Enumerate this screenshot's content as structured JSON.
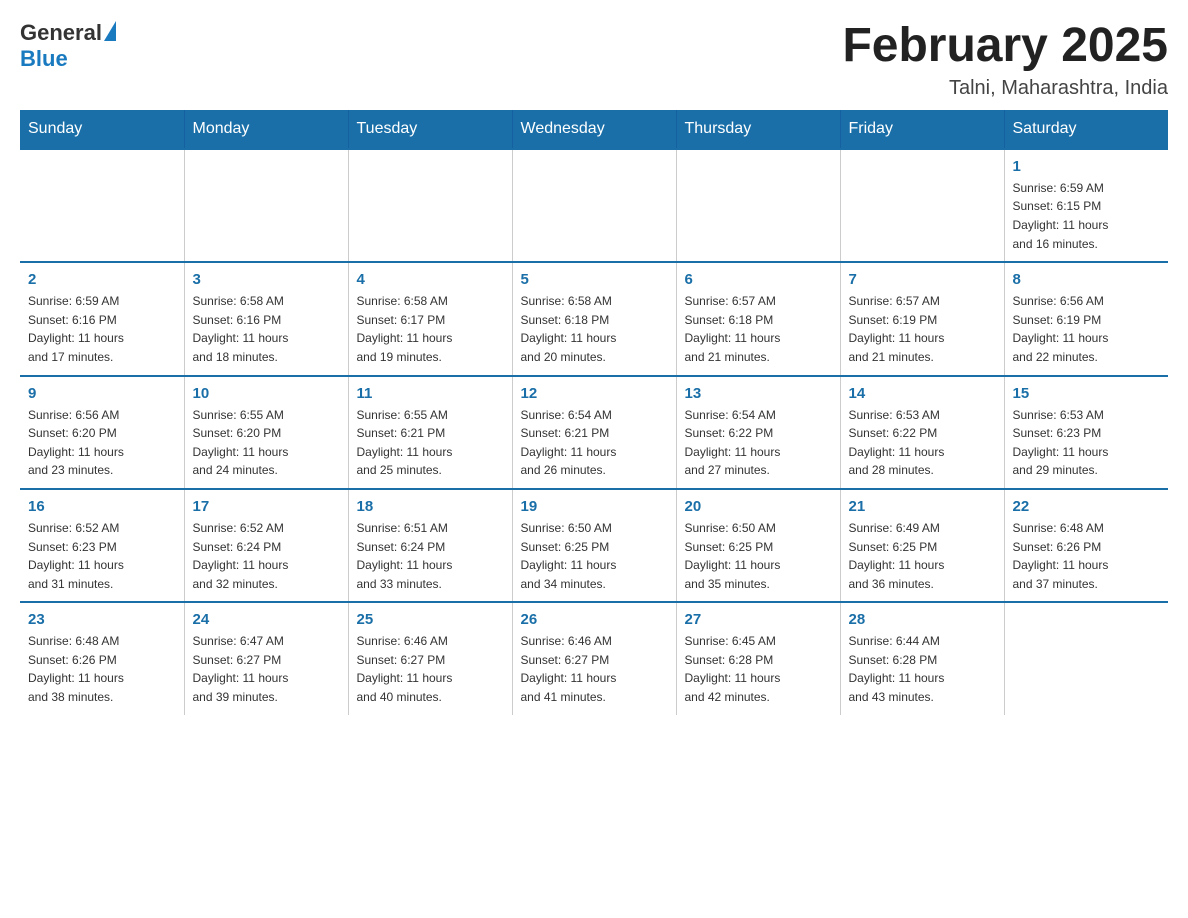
{
  "header": {
    "logo_general": "General",
    "logo_blue": "Blue",
    "month_year": "February 2025",
    "location": "Talni, Maharashtra, India"
  },
  "weekdays": [
    "Sunday",
    "Monday",
    "Tuesday",
    "Wednesday",
    "Thursday",
    "Friday",
    "Saturday"
  ],
  "weeks": [
    [
      {
        "day": "",
        "info": ""
      },
      {
        "day": "",
        "info": ""
      },
      {
        "day": "",
        "info": ""
      },
      {
        "day": "",
        "info": ""
      },
      {
        "day": "",
        "info": ""
      },
      {
        "day": "",
        "info": ""
      },
      {
        "day": "1",
        "info": "Sunrise: 6:59 AM\nSunset: 6:15 PM\nDaylight: 11 hours\nand 16 minutes."
      }
    ],
    [
      {
        "day": "2",
        "info": "Sunrise: 6:59 AM\nSunset: 6:16 PM\nDaylight: 11 hours\nand 17 minutes."
      },
      {
        "day": "3",
        "info": "Sunrise: 6:58 AM\nSunset: 6:16 PM\nDaylight: 11 hours\nand 18 minutes."
      },
      {
        "day": "4",
        "info": "Sunrise: 6:58 AM\nSunset: 6:17 PM\nDaylight: 11 hours\nand 19 minutes."
      },
      {
        "day": "5",
        "info": "Sunrise: 6:58 AM\nSunset: 6:18 PM\nDaylight: 11 hours\nand 20 minutes."
      },
      {
        "day": "6",
        "info": "Sunrise: 6:57 AM\nSunset: 6:18 PM\nDaylight: 11 hours\nand 21 minutes."
      },
      {
        "day": "7",
        "info": "Sunrise: 6:57 AM\nSunset: 6:19 PM\nDaylight: 11 hours\nand 21 minutes."
      },
      {
        "day": "8",
        "info": "Sunrise: 6:56 AM\nSunset: 6:19 PM\nDaylight: 11 hours\nand 22 minutes."
      }
    ],
    [
      {
        "day": "9",
        "info": "Sunrise: 6:56 AM\nSunset: 6:20 PM\nDaylight: 11 hours\nand 23 minutes."
      },
      {
        "day": "10",
        "info": "Sunrise: 6:55 AM\nSunset: 6:20 PM\nDaylight: 11 hours\nand 24 minutes."
      },
      {
        "day": "11",
        "info": "Sunrise: 6:55 AM\nSunset: 6:21 PM\nDaylight: 11 hours\nand 25 minutes."
      },
      {
        "day": "12",
        "info": "Sunrise: 6:54 AM\nSunset: 6:21 PM\nDaylight: 11 hours\nand 26 minutes."
      },
      {
        "day": "13",
        "info": "Sunrise: 6:54 AM\nSunset: 6:22 PM\nDaylight: 11 hours\nand 27 minutes."
      },
      {
        "day": "14",
        "info": "Sunrise: 6:53 AM\nSunset: 6:22 PM\nDaylight: 11 hours\nand 28 minutes."
      },
      {
        "day": "15",
        "info": "Sunrise: 6:53 AM\nSunset: 6:23 PM\nDaylight: 11 hours\nand 29 minutes."
      }
    ],
    [
      {
        "day": "16",
        "info": "Sunrise: 6:52 AM\nSunset: 6:23 PM\nDaylight: 11 hours\nand 31 minutes."
      },
      {
        "day": "17",
        "info": "Sunrise: 6:52 AM\nSunset: 6:24 PM\nDaylight: 11 hours\nand 32 minutes."
      },
      {
        "day": "18",
        "info": "Sunrise: 6:51 AM\nSunset: 6:24 PM\nDaylight: 11 hours\nand 33 minutes."
      },
      {
        "day": "19",
        "info": "Sunrise: 6:50 AM\nSunset: 6:25 PM\nDaylight: 11 hours\nand 34 minutes."
      },
      {
        "day": "20",
        "info": "Sunrise: 6:50 AM\nSunset: 6:25 PM\nDaylight: 11 hours\nand 35 minutes."
      },
      {
        "day": "21",
        "info": "Sunrise: 6:49 AM\nSunset: 6:25 PM\nDaylight: 11 hours\nand 36 minutes."
      },
      {
        "day": "22",
        "info": "Sunrise: 6:48 AM\nSunset: 6:26 PM\nDaylight: 11 hours\nand 37 minutes."
      }
    ],
    [
      {
        "day": "23",
        "info": "Sunrise: 6:48 AM\nSunset: 6:26 PM\nDaylight: 11 hours\nand 38 minutes."
      },
      {
        "day": "24",
        "info": "Sunrise: 6:47 AM\nSunset: 6:27 PM\nDaylight: 11 hours\nand 39 minutes."
      },
      {
        "day": "25",
        "info": "Sunrise: 6:46 AM\nSunset: 6:27 PM\nDaylight: 11 hours\nand 40 minutes."
      },
      {
        "day": "26",
        "info": "Sunrise: 6:46 AM\nSunset: 6:27 PM\nDaylight: 11 hours\nand 41 minutes."
      },
      {
        "day": "27",
        "info": "Sunrise: 6:45 AM\nSunset: 6:28 PM\nDaylight: 11 hours\nand 42 minutes."
      },
      {
        "day": "28",
        "info": "Sunrise: 6:44 AM\nSunset: 6:28 PM\nDaylight: 11 hours\nand 43 minutes."
      },
      {
        "day": "",
        "info": ""
      }
    ]
  ]
}
